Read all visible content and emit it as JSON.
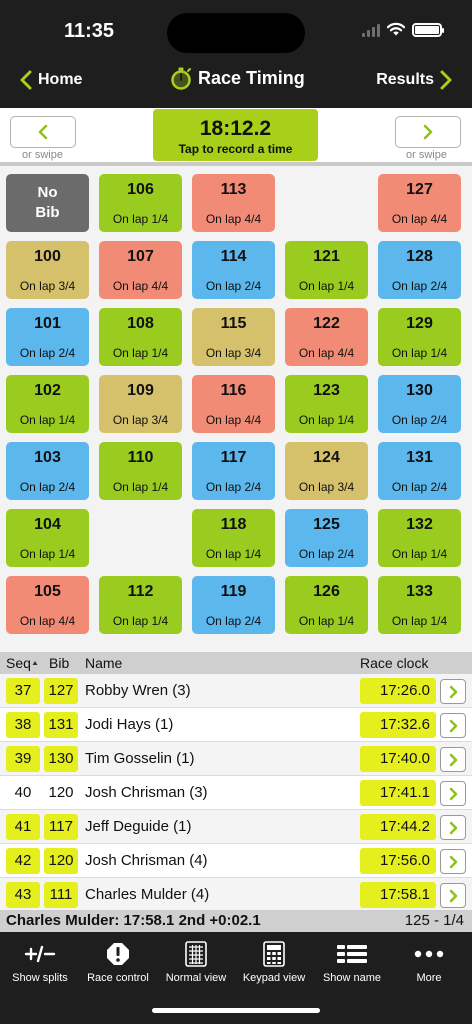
{
  "status": {
    "time": "11:35"
  },
  "nav": {
    "back_label": "Home",
    "title": "Race Timing",
    "results_label": "Results"
  },
  "controls": {
    "swipe_hint": "or swipe",
    "timer_value": "18:12.2",
    "timer_hint": "Tap to record a time"
  },
  "colors": {
    "green": "#99cc1f",
    "blue": "#5bb7ec",
    "red": "#f28b76",
    "tan": "#d5c06c",
    "highlight": "#e6ef1e"
  },
  "grid": {
    "no_bib_line1": "No",
    "no_bib_line2": "Bib",
    "tiles": [
      {
        "bib": "106",
        "lap": "On lap 1/4",
        "color": "green"
      },
      {
        "bib": "113",
        "lap": "On lap 4/4",
        "color": "red"
      },
      {
        "bib": "127",
        "lap": "On lap 4/4",
        "color": "red"
      },
      {
        "bib": "100",
        "lap": "On lap 3/4",
        "color": "tan"
      },
      {
        "bib": "107",
        "lap": "On lap 4/4",
        "color": "red"
      },
      {
        "bib": "114",
        "lap": "On lap 2/4",
        "color": "blue"
      },
      {
        "bib": "121",
        "lap": "On lap 1/4",
        "color": "green"
      },
      {
        "bib": "128",
        "lap": "On lap 2/4",
        "color": "blue"
      },
      {
        "bib": "101",
        "lap": "On lap 2/4",
        "color": "blue"
      },
      {
        "bib": "108",
        "lap": "On lap 1/4",
        "color": "green"
      },
      {
        "bib": "115",
        "lap": "On lap 3/4",
        "color": "tan"
      },
      {
        "bib": "122",
        "lap": "On lap 4/4",
        "color": "red"
      },
      {
        "bib": "129",
        "lap": "On lap 1/4",
        "color": "green"
      },
      {
        "bib": "102",
        "lap": "On lap 1/4",
        "color": "green"
      },
      {
        "bib": "109",
        "lap": "On lap 3/4",
        "color": "tan"
      },
      {
        "bib": "116",
        "lap": "On lap 4/4",
        "color": "red"
      },
      {
        "bib": "123",
        "lap": "On lap 1/4",
        "color": "green"
      },
      {
        "bib": "130",
        "lap": "On lap 2/4",
        "color": "blue"
      },
      {
        "bib": "103",
        "lap": "On lap 2/4",
        "color": "blue"
      },
      {
        "bib": "110",
        "lap": "On lap 1/4",
        "color": "green"
      },
      {
        "bib": "117",
        "lap": "On lap 2/4",
        "color": "blue"
      },
      {
        "bib": "124",
        "lap": "On lap 3/4",
        "color": "tan"
      },
      {
        "bib": "131",
        "lap": "On lap 2/4",
        "color": "blue"
      },
      {
        "bib": "104",
        "lap": "On lap 1/4",
        "color": "green"
      },
      {
        "bib": "118",
        "lap": "On lap 1/4",
        "color": "green"
      },
      {
        "bib": "125",
        "lap": "On lap 2/4",
        "color": "blue"
      },
      {
        "bib": "132",
        "lap": "On lap 1/4",
        "color": "green"
      },
      {
        "bib": "105",
        "lap": "On lap 4/4",
        "color": "red"
      },
      {
        "bib": "112",
        "lap": "On lap 1/4",
        "color": "green"
      },
      {
        "bib": "119",
        "lap": "On lap 2/4",
        "color": "blue"
      },
      {
        "bib": "126",
        "lap": "On lap 1/4",
        "color": "green"
      },
      {
        "bib": "133",
        "lap": "On lap 1/4",
        "color": "green"
      }
    ]
  },
  "table": {
    "headers": {
      "seq": "Seq",
      "bib": "Bib",
      "name": "Name",
      "race_clock": "Race clock"
    },
    "rows": [
      {
        "seq": "37",
        "bib": "127",
        "name": "Robby Wren (3)",
        "time": "17:26.0",
        "highlighted": true
      },
      {
        "seq": "38",
        "bib": "131",
        "name": "Jodi Hays (1)",
        "time": "17:32.6",
        "highlighted": true
      },
      {
        "seq": "39",
        "bib": "130",
        "name": "Tim Gosselin (1)",
        "time": "17:40.0",
        "highlighted": true
      },
      {
        "seq": "40",
        "bib": "120",
        "name": "Josh Chrisman (3)",
        "time": "17:41.1",
        "highlighted": false
      },
      {
        "seq": "41",
        "bib": "117",
        "name": "Jeff Deguide (1)",
        "time": "17:44.2",
        "highlighted": true
      },
      {
        "seq": "42",
        "bib": "120",
        "name": "Josh Chrisman (4)",
        "time": "17:56.0",
        "highlighted": true
      },
      {
        "seq": "43",
        "bib": "111",
        "name": "Charles Mulder (4)",
        "time": "17:58.1",
        "highlighted": true
      }
    ]
  },
  "summary": {
    "left": "Charles Mulder: 17:58.1 2nd +0:02.1",
    "right": "125 - 1/4"
  },
  "tabbar": {
    "items": [
      {
        "label": "Show splits",
        "icon": "plus-minus-icon"
      },
      {
        "label": "Race control",
        "icon": "alert-octagon-icon"
      },
      {
        "label": "Normal view",
        "icon": "grid-view-icon"
      },
      {
        "label": "Keypad view",
        "icon": "keypad-icon"
      },
      {
        "label": "Show name",
        "icon": "list-icon"
      },
      {
        "label": "More",
        "icon": "more-dots-icon"
      }
    ]
  }
}
